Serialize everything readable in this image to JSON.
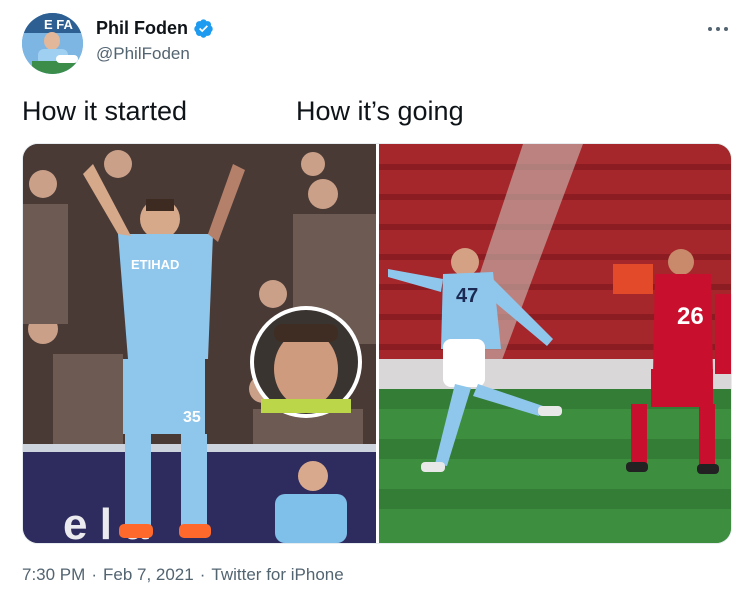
{
  "author": {
    "display_name": "Phil Foden",
    "handle": "@PhilFoden",
    "verified": true,
    "avatar_icon": "avatar-photo"
  },
  "tweet": {
    "caption_left": "How it started",
    "caption_right": "How it’s going",
    "time": "7:30 PM",
    "separator": "·",
    "date": "Feb 7, 2021",
    "source": "Twitter for iPhone"
  },
  "media": {
    "left_photo": {
      "kit_text": "ETIHAD",
      "number": "35"
    },
    "right_photo": {
      "player_number": "47",
      "opponent_number": "26"
    }
  },
  "colors": {
    "verified_blue": "#1d9bf0",
    "text_primary": "#0f1419",
    "text_secondary": "#536471",
    "city_sky_blue": "#8fc3ea",
    "liverpool_red": "#c8102e"
  }
}
